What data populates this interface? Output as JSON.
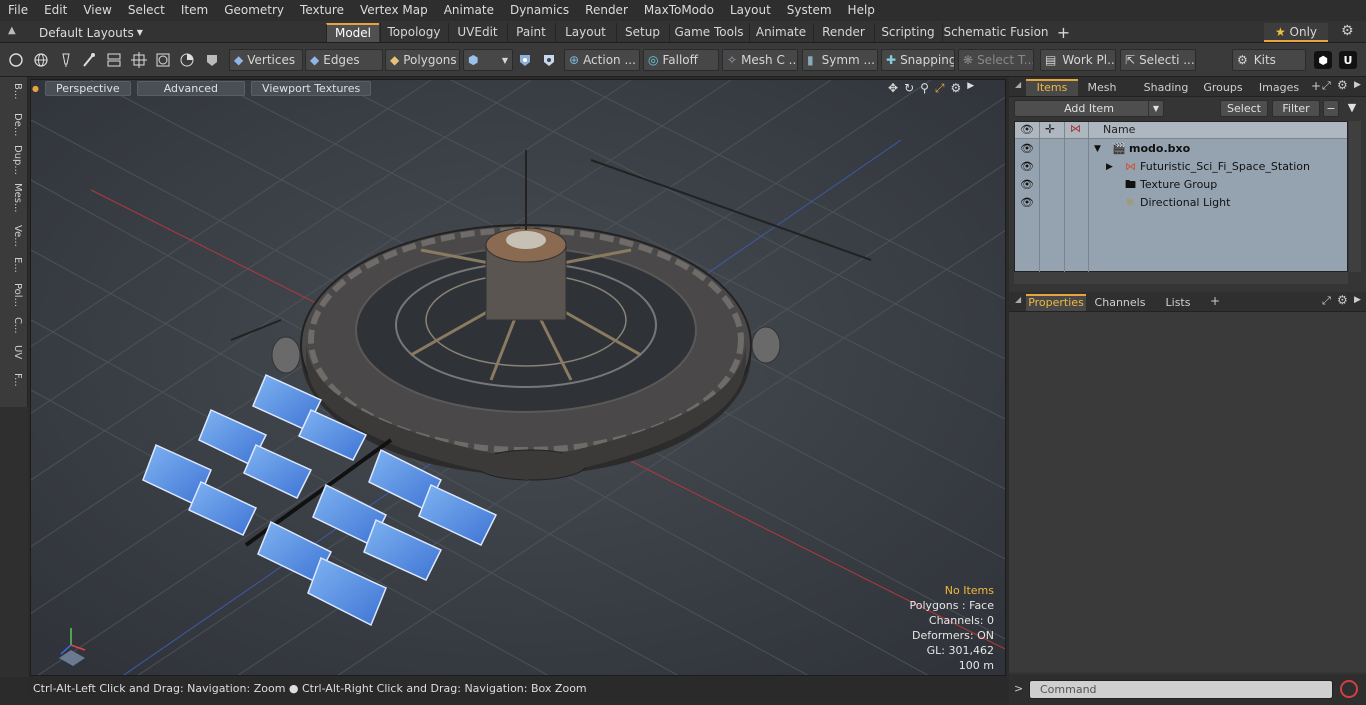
{
  "menu": [
    "File",
    "Edit",
    "View",
    "Select",
    "Item",
    "Geometry",
    "Texture",
    "Vertex Map",
    "Animate",
    "Dynamics",
    "Render",
    "MaxToModo",
    "Layout",
    "System",
    "Help"
  ],
  "layout_select": "Default Layouts",
  "tabs": [
    "Model",
    "Topology",
    "UVEdit",
    "Paint",
    "Layout",
    "Setup",
    "Game Tools",
    "Animate",
    "Render",
    "Scripting",
    "Schematic Fusion"
  ],
  "tab_plus": "+",
  "only_label": "Only",
  "toolbar": {
    "vertices": "Vertices",
    "edges": "Edges",
    "polygons": "Polygons",
    "action": "Action ...",
    "falloff": "Falloff",
    "meshc": "Mesh C ...",
    "symm": "Symm ...",
    "snapping": "Snapping",
    "selectt": "Select T...",
    "workpl": "Work Pl...",
    "selecti": "Selecti ...",
    "kits": "Kits"
  },
  "leftrail": [
    "B...",
    "De...",
    "Dup...",
    "Mes...",
    "Ve...",
    "E...",
    "Pol...",
    "C...",
    "UV",
    "F..."
  ],
  "viewport": {
    "perspective": "Perspective",
    "advanced": "Advanced",
    "textures": "Viewport Textures"
  },
  "stats": {
    "no_items": "No Items",
    "polygons": "Polygons : Face",
    "channels": "Channels: 0",
    "deformers": "Deformers: ON",
    "gl": "GL: 301,462",
    "scale": "100 m"
  },
  "status": "Ctrl-Alt-Left Click and Drag: Navigation: Zoom ● Ctrl-Alt-Right Click and Drag: Navigation: Box Zoom",
  "rpanel": {
    "tabs": [
      "Items",
      "Mesh ...",
      "Shading",
      "Groups",
      "Images"
    ],
    "add_item": "Add Item",
    "select": "Select",
    "filter": "Filter",
    "name_col": "Name",
    "items": [
      {
        "name": "modo.bxo",
        "bold": true
      },
      {
        "name": "Futuristic_Sci_Fi_Space_Station"
      },
      {
        "name": "Texture Group"
      },
      {
        "name": "Directional Light"
      }
    ],
    "ptabs": [
      "Properties",
      "Channels",
      "Lists"
    ],
    "command": "Command"
  },
  "colors": {
    "accent": "#e8a33d",
    "list_bg": "#95a3b0",
    "viewport_bg": "#3e434a"
  }
}
